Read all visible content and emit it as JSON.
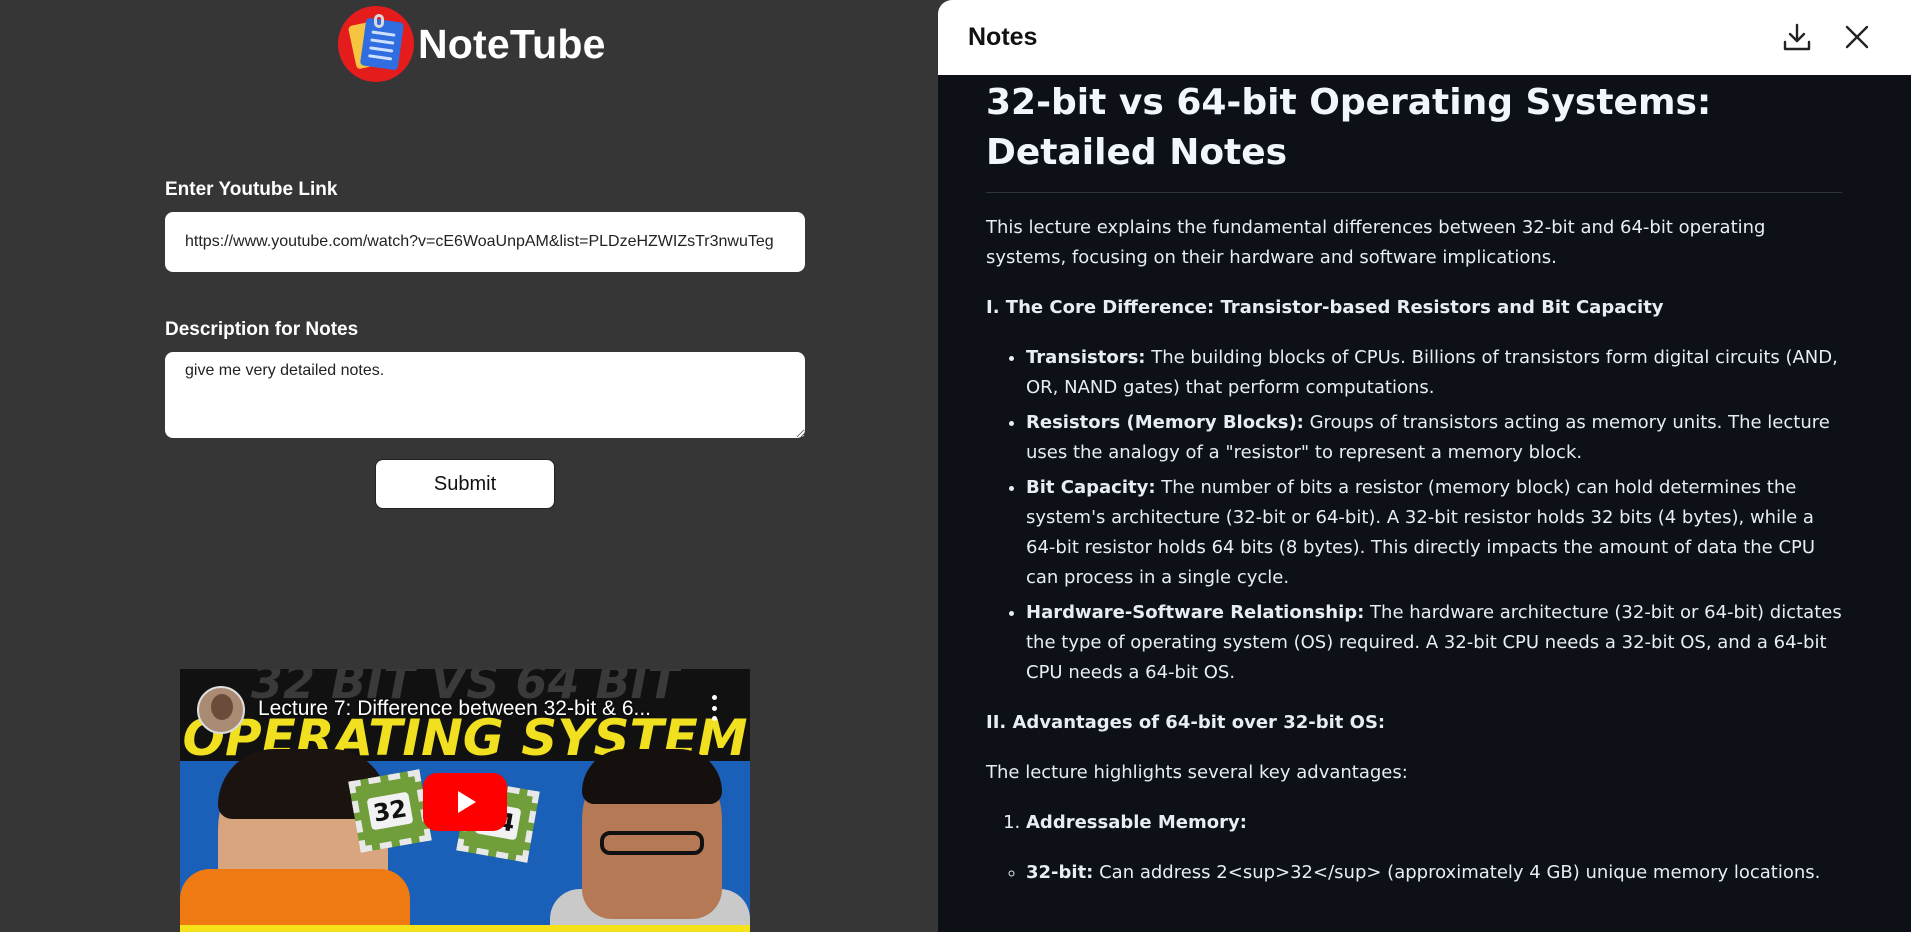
{
  "app": {
    "name": "NoteTube"
  },
  "form": {
    "url_label": "Enter Youtube Link",
    "url_value": "https://www.youtube.com/watch?v=cE6WoaUnpAM&list=PLDzeHZWIZsTr3nwuTeg",
    "desc_label": "Description for Notes",
    "desc_value": "give me very detailed notes.",
    "submit_label": "Submit"
  },
  "video": {
    "title": "Lecture 7: Difference between 32-bit & 6...",
    "thumbnail_heading_1": "32 BIT VS 64 BIT",
    "thumbnail_heading_2": "OPERATING SYSTEM",
    "chip_1": "32",
    "chip_2": "64"
  },
  "notes_panel": {
    "title": "Notes",
    "download_icon": "download-icon",
    "close_icon": "close-icon",
    "heading": "32-bit vs 64-bit Operating Systems: Detailed Notes",
    "intro": "This lecture explains the fundamental differences between 32-bit and 64-bit operating systems, focusing on their hardware and software implications.",
    "section1_title": "I. The Core Difference: Transistor-based Resistors and Bit Capacity",
    "section1_items": [
      {
        "term": "Transistors:",
        "text": " The building blocks of CPUs. Billions of transistors form digital circuits (AND, OR, NAND gates) that perform computations."
      },
      {
        "term": "Resistors (Memory Blocks):",
        "text": " Groups of transistors acting as memory units. The lecture uses the analogy of a \"resistor\" to represent a memory block."
      },
      {
        "term": "Bit Capacity:",
        "text": " The number of bits a resistor (memory block) can hold determines the system's architecture (32-bit or 64-bit). A 32-bit resistor holds 32 bits (4 bytes), while a 64-bit resistor holds 64 bits (8 bytes). This directly impacts the amount of data the CPU can process in a single cycle."
      },
      {
        "term": "Hardware-Software Relationship:",
        "text": " The hardware architecture (32-bit or 64-bit) dictates the type of operating system (OS) required. A 32-bit CPU needs a 32-bit OS, and a 64-bit CPU needs a 64-bit OS."
      }
    ],
    "section2_title": "II. Advantages of 64-bit over 32-bit OS:",
    "section2_intro": "The lecture highlights several key advantages:",
    "section2_numbered": [
      {
        "term": "Addressable Memory:"
      }
    ],
    "section2_sub": [
      {
        "term": "32-bit:",
        "text": " Can address 2<sup>32</sup> (approximately 4 GB) unique memory locations."
      }
    ]
  }
}
